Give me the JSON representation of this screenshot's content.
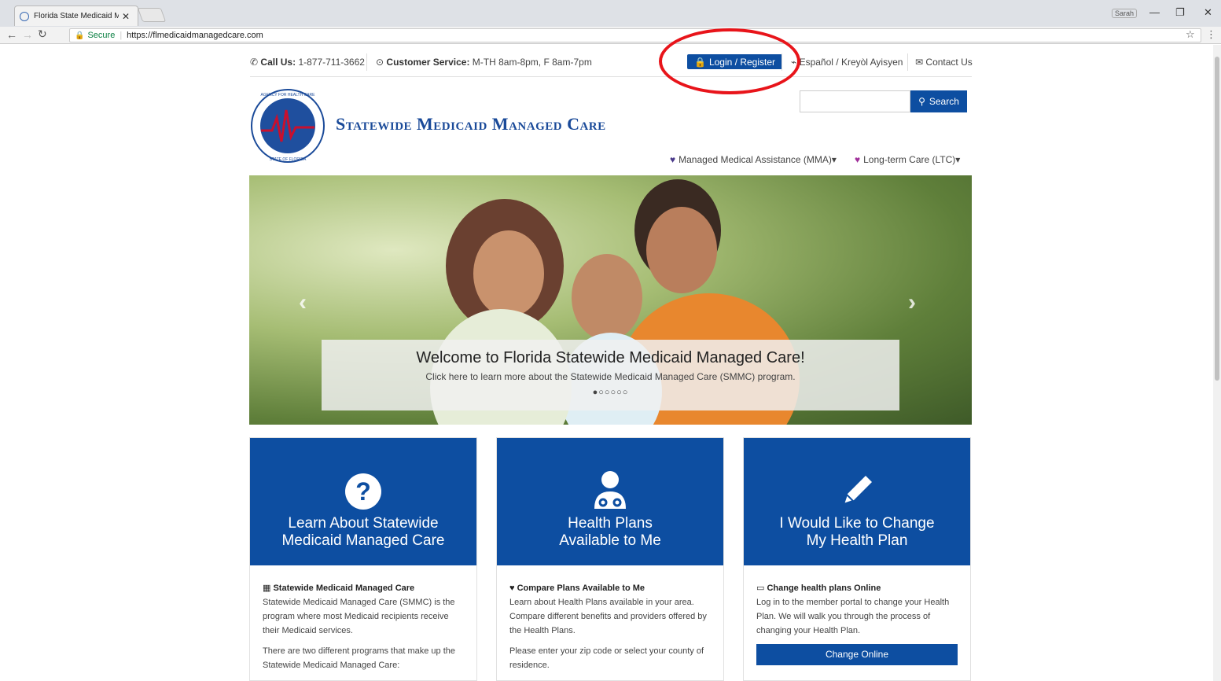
{
  "browser": {
    "tab_title": "Florida State Medicaid M",
    "user_chip": "Sarah",
    "secure_label": "Secure",
    "url": "https://flmedicaidmanagedcare.com"
  },
  "topbar": {
    "call_label": "Call Us:",
    "call_number": "1-877-711-3662",
    "service_label": "Customer Service:",
    "service_hours": "M-TH 8am-8pm, F 8am-7pm",
    "login_label": "Login / Register",
    "language_label": "Español / Kreyòl Ayisyen",
    "contact_label": "Contact Us"
  },
  "header": {
    "site_title": "Statewide Medicaid Managed Care",
    "search_button": "Search",
    "search_value": ""
  },
  "nav": {
    "mma": "Managed Medical Assistance (MMA)",
    "ltc": "Long-term Care (LTC)"
  },
  "hero": {
    "heading": "Welcome to Florida Statewide Medicaid Managed Care!",
    "subtext": "Click here to learn more about the Statewide Medicaid Managed Care (SMMC) program.",
    "indicator": "●○○○○○"
  },
  "cards": [
    {
      "title_line1": "Learn About Statewide",
      "title_line2": "Medicaid Managed Care",
      "subhead": "Statewide Medicaid Managed Care",
      "p1": "Statewide Medicaid Managed Care (SMMC) is the program where most Medicaid recipients receive their Medicaid services.",
      "p2": "There are two different programs that make up the Statewide Medicaid Managed Care:"
    },
    {
      "title_line1": "Health Plans",
      "title_line2": "Available to Me",
      "subhead": "Compare Plans Available to Me",
      "p1": "Learn about Health Plans available in your area. Compare different benefits and providers offered by the Health Plans.",
      "p2": "Please enter your zip code or select your county of residence."
    },
    {
      "title_line1": "I Would Like to Change",
      "title_line2": "My Health Plan",
      "subhead": "Change health plans Online",
      "p1": "Log in to the member portal to change your Health Plan. We will walk you through the process of changing your Health Plan.",
      "button": "Change Online"
    }
  ],
  "colors": {
    "brand_blue": "#0d4ea1",
    "annotation_red": "#e8141a"
  }
}
